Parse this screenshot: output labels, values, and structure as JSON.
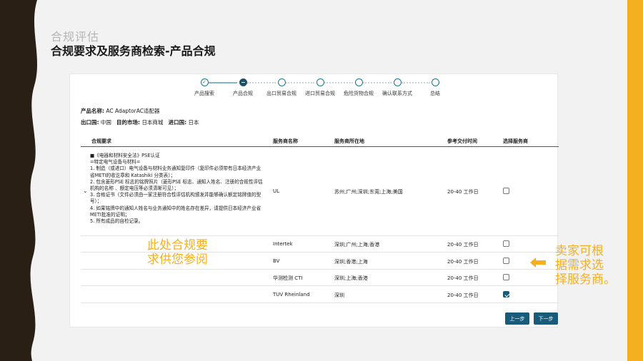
{
  "slide": {
    "subtitle": "合规评估",
    "title": "合规要求及服务商检索-产品合规",
    "colors": {
      "left_band": "#2a1f14",
      "right_band": "#f5b021",
      "accent": "#1a5b7a",
      "annotation": "#f5b021"
    }
  },
  "stepper": {
    "steps": [
      {
        "label": "产品搜索",
        "state": "done"
      },
      {
        "label": "产品合规",
        "state": "current"
      },
      {
        "label": "出口贸易合规",
        "state": "todo"
      },
      {
        "label": "进口贸易合规",
        "state": "todo"
      },
      {
        "label": "危险货物合规",
        "state": "todo"
      },
      {
        "label": "确认联系方式",
        "state": "todo"
      },
      {
        "label": "总结",
        "state": "todo"
      }
    ]
  },
  "product": {
    "name_label": "产品名称:",
    "name_value": "AC AdaptorAC适配器",
    "export_label": "出口国:",
    "export_value": "中国",
    "target_label": "目的市场:",
    "target_value": "日本商城",
    "import_label": "进口国:",
    "import_value": "日本"
  },
  "table": {
    "headers": {
      "requirement": "合规要求",
      "provider": "服务商名称",
      "location": "服务商所在地",
      "delivery": "参考交付时间",
      "select": "选择服务商"
    },
    "requirement_lines": [
      "■《电器和材料安全法》PSE认证",
      "=特定电气设备与材料=",
      "1. 制造（或进口）电气设备与材料业务通知复印件（复印件必须带有日本经济产业",
      "省METI的收讫章和 Katashiki 分类表）；",
      "2. 包含菱形PSE 标志的铭牌照片（菱形PSE 标志、通知人姓名、注册的合规性评估",
      "机构的名称 、额定电压等必须清晰可见）；",
      "3. 合格证书（文件必须由一家注册符合性评估机构颁发并能够确认额定铭牌值的型",
      "号）；",
      "4. 如果铭牌中的通知人姓名与业务通知中的姓名存在差异，请提供日本经济产业省",
      "METI批准的证明；",
      "5. 所有成品的自检记录。"
    ],
    "rows": [
      {
        "provider": "UL",
        "location": "苏州;广州;深圳;东莞;上海;美国",
        "delivery": "20-40 工作日",
        "selected": false
      },
      {
        "provider": "Intertek",
        "location": "深圳;广州;上海;香港",
        "delivery": "20-40 工作日",
        "selected": false
      },
      {
        "provider": "BV",
        "location": "深圳;香港;上海",
        "delivery": "20-40 工作日",
        "selected": false
      },
      {
        "provider": "华测检测 CTI",
        "location": "深圳;上海;香港",
        "delivery": "20-40 工作日",
        "selected": false
      },
      {
        "provider": "TUV Rheinland",
        "location": "深圳",
        "delivery": "20-40 工作日",
        "selected": true
      }
    ]
  },
  "annotations": {
    "middle": [
      "此处合规要",
      "求供您参阅"
    ],
    "right": [
      "卖家可根",
      "据需求选",
      "择服务商。"
    ]
  },
  "buttons": {
    "prev": "上一步",
    "next": "下一步"
  }
}
